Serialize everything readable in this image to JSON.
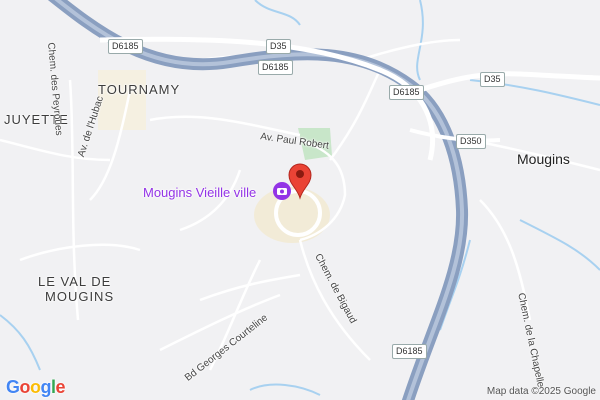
{
  "map": {
    "places": {
      "tournamy": "TOURNAMY",
      "juyette": "JUYETTE",
      "val_de_mougins_line1": "LE VAL DE",
      "val_de_mougins_line2": "MOUGINS",
      "mougins": "Mougins"
    },
    "poi": {
      "name": "Mougins Vieille ville",
      "icon": "camera-icon",
      "marker_icon": "map-pin-icon",
      "marker_color": "#ea4335",
      "poi_color": "#9334e6"
    },
    "streets": {
      "paul_robert": "Av. Paul Robert",
      "hubac": "Av. de l'Hubac",
      "peyroues": "Chem. des Peyroues",
      "bigaud": "Chem. de Bigaud",
      "courteline": "Bd Georges Courteline",
      "chapelle": "Chem. de la Chapelle"
    },
    "shields": {
      "d6185_a": "D6185",
      "d35_a": "D35",
      "d6185_b": "D6185",
      "d6185_c": "D6185",
      "d35_b": "D35",
      "d350": "D350",
      "d6185_d": "D6185"
    },
    "colors": {
      "highway": "#8a9fc0",
      "water": "#a8d1f0",
      "background": "#f1f1f3",
      "park": "#c8e6c9"
    },
    "attribution": "Map data ©2025 Google",
    "logo": {
      "g1": "G",
      "o1": "o",
      "o2": "o",
      "g2": "g",
      "l": "l",
      "e": "e"
    }
  }
}
